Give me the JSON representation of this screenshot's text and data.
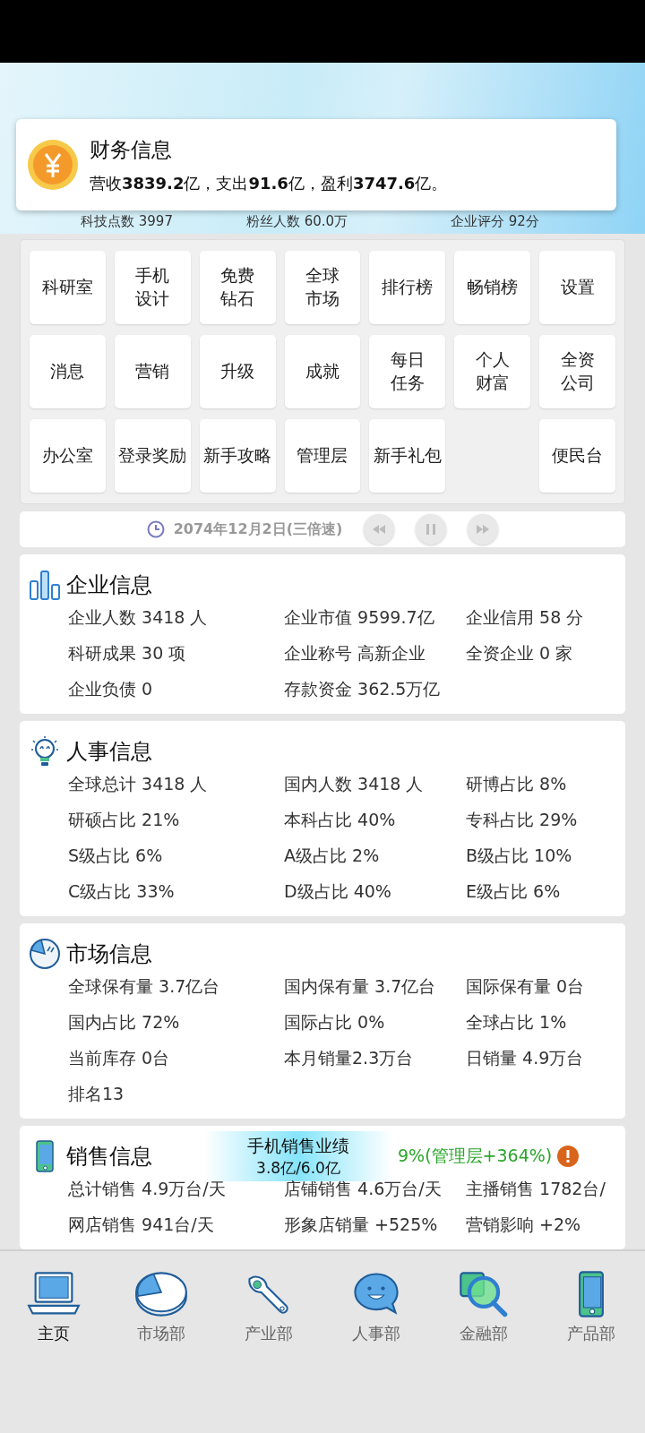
{
  "header": {
    "stats": [
      "科技点数 3997",
      "粉丝人数 60.0万",
      "企业评分 92分"
    ]
  },
  "toast": {
    "title": "财务信息",
    "text": "营收**3839.2**亿，支出**91.6**亿，盈利**3747.6**亿。"
  },
  "menu": [
    {
      "kind": "tile",
      "lines": [
        "科研室"
      ]
    },
    {
      "kind": "tile",
      "lines": [
        "手机",
        "设计"
      ]
    },
    {
      "kind": "tile",
      "lines": [
        "免费",
        "钻石"
      ]
    },
    {
      "kind": "tile",
      "lines": [
        "全球",
        "市场"
      ]
    },
    {
      "kind": "tile",
      "lines": [
        "排行榜"
      ]
    },
    {
      "kind": "tile",
      "lines": [
        "畅销榜"
      ]
    },
    {
      "kind": "tile",
      "lines": [
        "设置"
      ]
    },
    {
      "kind": "tile",
      "lines": [
        "消息"
      ]
    },
    {
      "kind": "tile",
      "lines": [
        "营销"
      ]
    },
    {
      "kind": "tile",
      "lines": [
        "升级"
      ]
    },
    {
      "kind": "tile",
      "lines": [
        "成就"
      ]
    },
    {
      "kind": "tile",
      "lines": [
        "每日",
        "任务"
      ]
    },
    {
      "kind": "tile",
      "lines": [
        "个人",
        "财富"
      ]
    },
    {
      "kind": "tile",
      "lines": [
        "全资",
        "公司"
      ]
    },
    {
      "kind": "tile",
      "lines": [
        "办公室"
      ]
    },
    {
      "kind": "tile",
      "lines": [
        "登录奖励"
      ]
    },
    {
      "kind": "tile",
      "lines": [
        "新手攻略"
      ]
    },
    {
      "kind": "tile",
      "lines": [
        "管理层"
      ]
    },
    {
      "kind": "tile",
      "lines": [
        "新手礼包"
      ]
    },
    {
      "kind": "blank"
    },
    {
      "kind": "tile",
      "lines": [
        "便民台"
      ]
    }
  ],
  "time_bar": {
    "date": "2074年12月2日(三倍速)"
  },
  "sections": [
    {
      "kind": "company",
      "title": "企业信息",
      "items": [
        "企业人数 3418 人",
        "企业市值 9599.7亿",
        "企业信用 58 分",
        "科研成果 30 项",
        "企业称号 高新企业",
        "全资企业 0 家",
        "企业负债 0",
        "存款资金 362.5万亿"
      ]
    },
    {
      "kind": "hr",
      "title": "人事信息",
      "items": [
        "全球总计 3418 人",
        "国内人数 3418 人",
        "研博占比 8%",
        "研硕占比 21%",
        "本科占比 40%",
        "专科占比 29%",
        "S级占比 6%",
        "A级占比 2%",
        "B级占比 10%",
        "C级占比 33%",
        "D级占比 40%",
        "E级占比 6%"
      ]
    },
    {
      "kind": "market",
      "title": "市场信息",
      "items": [
        "全球保有量 3.7亿台",
        "国内保有量 3.7亿台",
        "国际保有量 0台",
        "国内占比 72%",
        "国际占比 0%",
        "全球占比 1%",
        "当前库存 0台",
        "本月销量2.3万台",
        "日销量 4.9万台",
        "排名13"
      ]
    },
    {
      "kind": "sales",
      "title": "销售信息",
      "banner": {
        "title": "手机销售业绩",
        "value": "3.8亿/6.0亿",
        "note": "9%(管理层+364%)"
      },
      "items": [
        "总计销售 4.9万台/天",
        "店铺销售 4.6万台/天",
        "主播销售 1782台/",
        "网店销售 941台/天",
        "形象店销量 +525%",
        "营销影响 +2%"
      ]
    }
  ],
  "nav": [
    {
      "kind": "laptop",
      "label": "主页",
      "selected": true
    },
    {
      "kind": "pie",
      "label": "市场部",
      "selected": false
    },
    {
      "kind": "wrench",
      "label": "产业部",
      "selected": false
    },
    {
      "kind": "chat",
      "label": "人事部",
      "selected": false
    },
    {
      "kind": "magnifier",
      "label": "金融部",
      "selected": false
    },
    {
      "kind": "phone",
      "label": "产品部",
      "selected": false
    }
  ]
}
